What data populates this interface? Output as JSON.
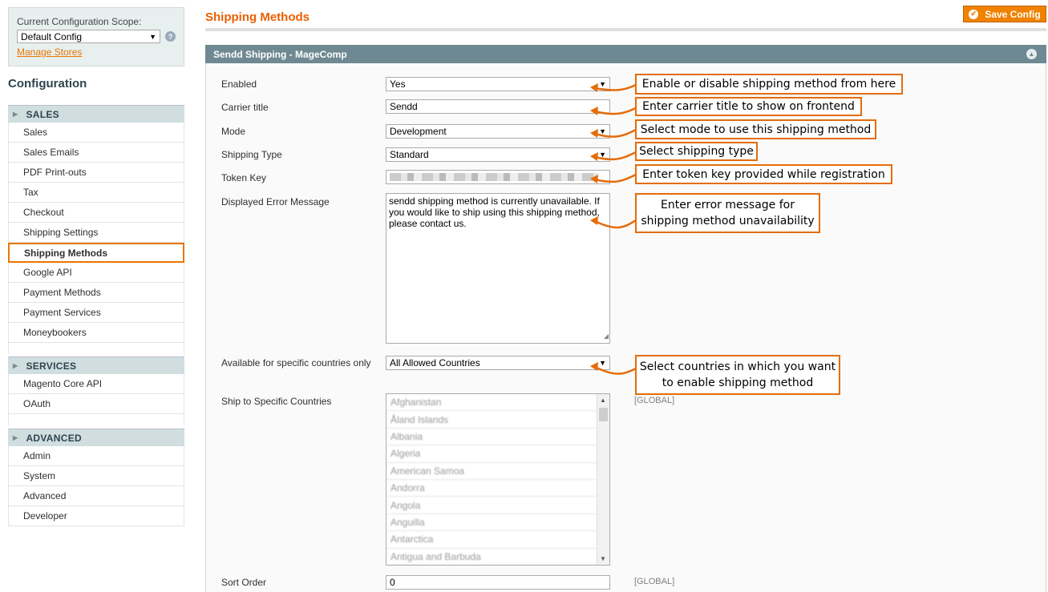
{
  "sidebar": {
    "scope_label": "Current Configuration Scope:",
    "scope_value": "Default Config",
    "manage_stores": "Manage Stores",
    "config_title": "Configuration",
    "groups": [
      {
        "label": "SALES",
        "items": [
          "Sales",
          "Sales Emails",
          "PDF Print-outs",
          "Tax",
          "Checkout",
          "Shipping Settings",
          "Shipping Methods",
          "Google API",
          "Payment Methods",
          "Payment Services",
          "Moneybookers"
        ]
      },
      {
        "label": "SERVICES",
        "items": [
          "Magento Core API",
          "OAuth"
        ]
      },
      {
        "label": "ADVANCED",
        "items": [
          "Admin",
          "System",
          "Advanced",
          "Developer"
        ]
      }
    ],
    "active_item": "Shipping Methods"
  },
  "header": {
    "page_title": "Shipping Methods",
    "save_label": "Save Config"
  },
  "section": {
    "title": "Sendd Shipping - MageComp",
    "fields": {
      "enabled": {
        "label": "Enabled",
        "value": "Yes"
      },
      "carrier_title": {
        "label": "Carrier title",
        "value": "Sendd"
      },
      "mode": {
        "label": "Mode",
        "value": "Development"
      },
      "shipping_type": {
        "label": "Shipping Type",
        "value": "Standard"
      },
      "token_key": {
        "label": "Token Key"
      },
      "error_message": {
        "label": "Displayed Error Message",
        "value": "sendd shipping method is currently unavailable. If you would like to ship using this shipping method, please contact us."
      },
      "specific_countries": {
        "label": "Available for specific countries only",
        "value": "All Allowed Countries"
      },
      "ship_to": {
        "label": "Ship to Specific Countries",
        "scope": "[GLOBAL]"
      },
      "sort_order": {
        "label": "Sort Order",
        "value": "0",
        "scope": "[GLOBAL]"
      }
    },
    "countries": [
      "Afghanistan",
      "Åland Islands",
      "Albania",
      "Algeria",
      "American Samoa",
      "Andorra",
      "Angola",
      "Anguilla",
      "Antarctica",
      "Antigua and Barbuda"
    ]
  },
  "callouts": {
    "enabled": "Enable or disable shipping method from here",
    "carrier_title": "Enter carrier title to show on frontend",
    "mode": "Select mode to use this shipping method",
    "shipping_type": "Select shipping type",
    "token_key": "Enter token key provided while registration",
    "error_line1": "Enter error message for",
    "error_line2": "shipping method unavailability",
    "countries_line1": "Select countries in which you want",
    "countries_line2": "to enable shipping method"
  },
  "colors": {
    "accent": "#ea7601",
    "section_header": "#6f8992",
    "callout_border": "#e46c0a"
  }
}
